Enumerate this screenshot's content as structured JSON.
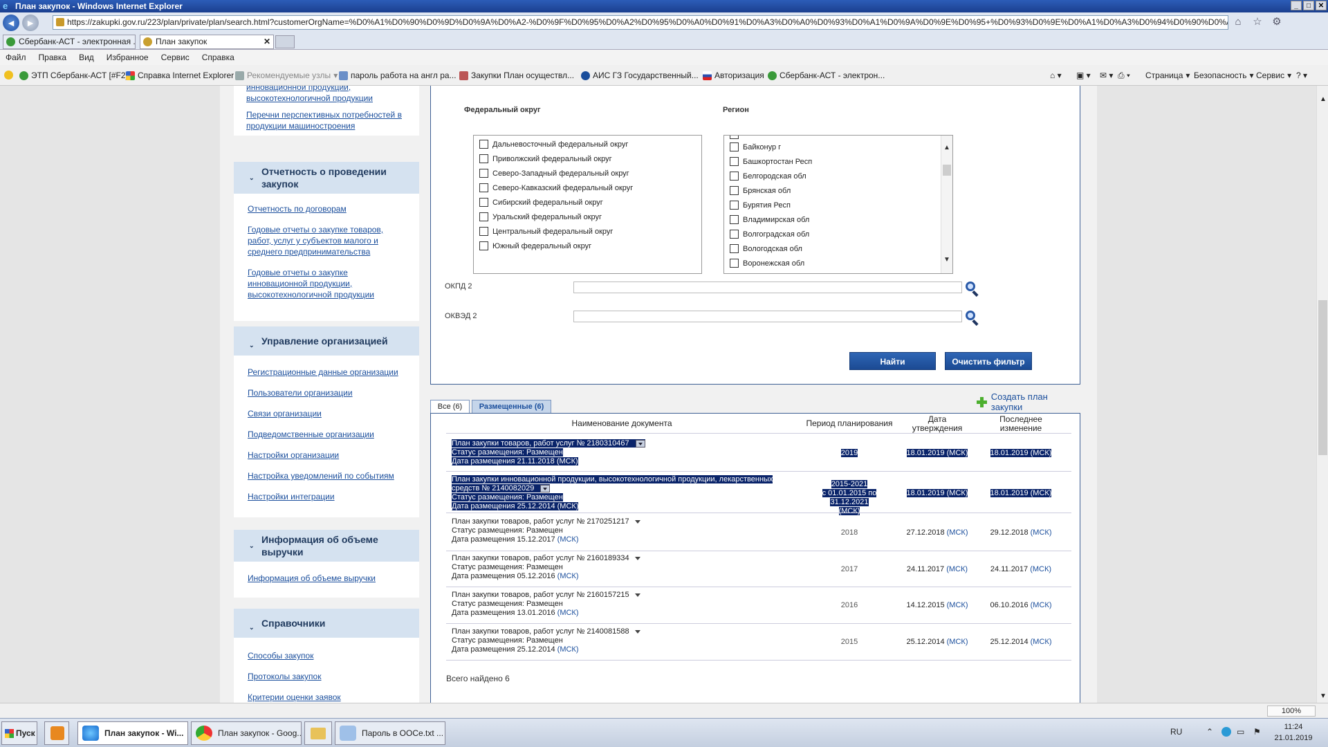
{
  "window": {
    "title": "План закупок - Windows Internet Explorer"
  },
  "address": {
    "url": "https://zakupki.gov.ru/223/plan/private/plan/search.html?customerOrgName=%D0%A1%D0%90%D0%9D%D0%9A%D0%A2-%D0%9F%D0%95%D0%A2%D0%95%D0%A0%D0%91%D0%A3%D0%A0%D0%93%D0%A1%D0%9A%D0%9E%D0%95+%D0%93%D0%9E%D0%A1%D0%A3%D0%94%D0%90%D0%A0%D0%A1%D0"
  },
  "tabs": [
    {
      "label": "Сбербанк-АСТ - электронная ..."
    },
    {
      "label": "План закупок"
    }
  ],
  "menu": [
    "Файл",
    "Правка",
    "Вид",
    "Избранное",
    "Сервис",
    "Справка"
  ],
  "favorites": [
    "ЭТП Сбербанк-АСТ [#F2]",
    "Справка Internet Explorer",
    "Рекомендуемые узлы",
    "пароль работа на англ ра...",
    "Закупки  План осуществл...",
    "АИС ГЗ  Государственный...",
    "Авторизация",
    "Сбербанк-АСТ - электрон..."
  ],
  "favbar_right": [
    "Страница",
    "Безопасность",
    "Сервис"
  ],
  "sidebar": {
    "top_links": [
      "инновационной продукции,\nвысокотехнологичной продукции",
      "Перечни перспективных потребностей в\nпродукции машиностроения"
    ],
    "sections": [
      {
        "title": "Отчетность о проведении\nзакупок",
        "links": [
          "Отчетность по договорам",
          "Годовые отчеты о закупке товаров,\nработ, услуг у субъектов малого и\nсреднего предпринимательства",
          "Годовые отчеты о закупке\nинновационной продукции,\nвысокотехнологичной продукции"
        ]
      },
      {
        "title": "Управление организацией",
        "links": [
          "Регистрационные данные организации",
          "Пользователи организации",
          "Связи организации",
          "Подведомственные организации",
          "Настройки организации",
          "Настройка уведомлений по событиям",
          "Настройки интеграции"
        ]
      },
      {
        "title": "Информация об объеме\nвыручки",
        "links": [
          "Информация об объеме выручки"
        ]
      },
      {
        "title": "Справочники",
        "links": [
          "Способы закупок",
          "Протоколы закупок",
          "Критерии оценки заявок"
        ]
      }
    ]
  },
  "filter": {
    "federal_district_label": "Федеральный округ",
    "region_label": "Регион",
    "districts": [
      "Дальневосточный федеральный округ",
      "Приволжский федеральный округ",
      "Северо-Западный федеральный округ",
      "Северо-Кавказский федеральный округ",
      "Сибирский федеральный округ",
      "Уральский федеральный округ",
      "Центральный федеральный округ",
      "Южный федеральный округ"
    ],
    "regions": [
      "Байконур г",
      "Башкортостан Респ",
      "Белгородская обл",
      "Брянская обл",
      "Бурятия Респ",
      "Владимирская обл",
      "Волгоградская обл",
      "Вологодская обл",
      "Воронежская обл"
    ],
    "okpd_label": "ОКПД 2",
    "okved_label": "ОКВЭД 2",
    "find_button": "Найти",
    "clear_button": "Очистить фильтр"
  },
  "create_plan_link": "Создать план закупки",
  "result_tabs": [
    "Все (6)",
    "Размещенные (6)"
  ],
  "table": {
    "headers": [
      "Наименование документа",
      "Период планирования",
      "Дата\nутверждения",
      "Последнее\nизменение"
    ],
    "msk": "(МСК)",
    "rows": [
      {
        "name": "План закупки товаров, работ услуг № 2180310467",
        "status": "Статус размещения: Размещен",
        "placed": "Дата размещения 21.11.2018 (МСК)",
        "period": "2019",
        "approved": "18.01.2019 (МСК)",
        "changed": "18.01.2019 (МСК)"
      },
      {
        "name_line1": "План закупки инновационной продукции, высокотехнологичной продукции, лекарственных",
        "name_line2": "средств № 2140082029",
        "status": "Статус размещения: Размещен",
        "placed": "Дата размещения 25.12.2014 (МСК)",
        "period_line1": "2015-2021",
        "period_line2": "с 01.01.2015 по 31.12.2021",
        "period_line3": "(МСК)",
        "approved": "18.01.2019 (МСК)",
        "changed": "18.01.2019 (МСК)"
      },
      {
        "name": "План закупки товаров, работ услуг № 2170251217",
        "status": "Статус размещения: Размещен",
        "placed": "Дата размещения 15.12.2017",
        "period": "2018",
        "approved": "27.12.2018",
        "changed": "29.12.2018"
      },
      {
        "name": "План закупки товаров, работ услуг № 2160189334",
        "status": "Статус размещения: Размещен",
        "placed": "Дата размещения 05.12.2016",
        "period": "2017",
        "approved": "24.11.2017",
        "changed": "24.11.2017"
      },
      {
        "name": "План закупки товаров, работ услуг № 2160157215",
        "status": "Статус размещения: Размещен",
        "placed": "Дата размещения 13.01.2016",
        "period": "2016",
        "approved": "14.12.2015",
        "changed": "06.10.2016"
      },
      {
        "name": "План закупки товаров, работ услуг № 2140081588",
        "status": "Статус размещения: Размещен",
        "placed": "Дата размещения 25.12.2014",
        "period": "2015",
        "approved": "25.12.2014",
        "changed": "25.12.2014"
      }
    ],
    "total": "Всего найдено 6"
  },
  "statusbar": {
    "zoom": "100%"
  },
  "taskbar": {
    "start": "Пуск",
    "items": [
      "План закупок - Wi...",
      "План закупок - Goog...",
      "Пароль в ООСе.txt ..."
    ],
    "lang": "RU",
    "time": "11:24",
    "date": "21.01.2019"
  }
}
